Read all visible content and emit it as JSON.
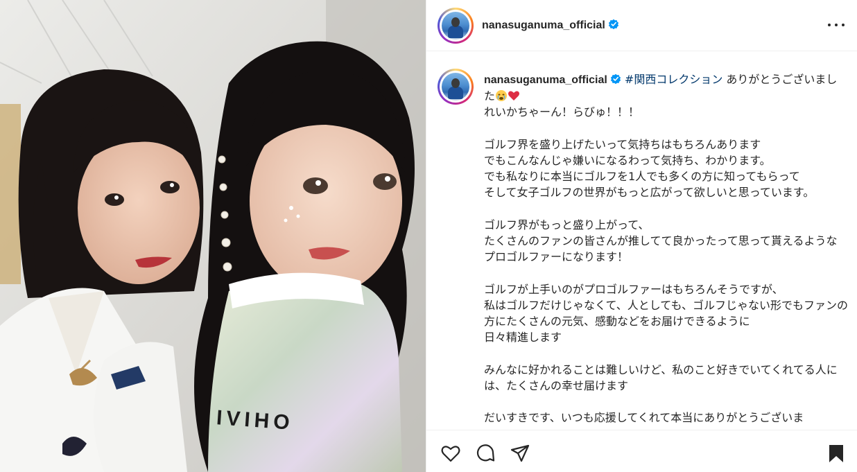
{
  "post": {
    "username": "nanasuganuma_official",
    "verified": true,
    "photo_description_icons": [
      "person-icon"
    ],
    "caption": {
      "username": "nanasuganuma_official",
      "hashtag": "#関西コレクション",
      "first_line_rest": " ありがとうございました",
      "emojis": [
        "crying-face-emoji",
        "red-heart-emoji"
      ],
      "body": "れいかちゃーん！らびゅ！！！\n\nゴルフ界を盛り上げたいって気持ちはもちろんあります\nでもこんなんじゃ嫌いになるわって気持ち、わかります。\nでも私なりに本当にゴルフを1人でも多くの方に知ってもらって\nそして女子ゴルフの世界がもっと広がって欲しいと思っています。\n\nゴルフ界がもっと盛り上がって、\nたくさんのファンの皆さんが推してて良かったって思って貰えるようなプロゴルファーになります！\n\nゴルフが上手いのがプロゴルファーはもちろんそうですが、\n私はゴルフだけじゃなくて、人としても、ゴルフじゃない形でもファンの方にたくさんの元気、感動などをお届けできるように\n日々精進します\n\nみんなに好かれることは難しいけど、私のこと好きでいてくれてる人には、たくさんの幸せ届けます\n\nだいすきです、いつも応援してくれて本当にありがとうございま"
    }
  },
  "photo": {
    "shirt_text": "IVIHO"
  },
  "actions": [
    "heart-icon",
    "comment-icon",
    "share-icon",
    "bookmark-icon"
  ],
  "colors": {
    "hashtag": "#00376b",
    "verified": "#0095f6",
    "text": "#262626",
    "divider": "#efefef"
  }
}
